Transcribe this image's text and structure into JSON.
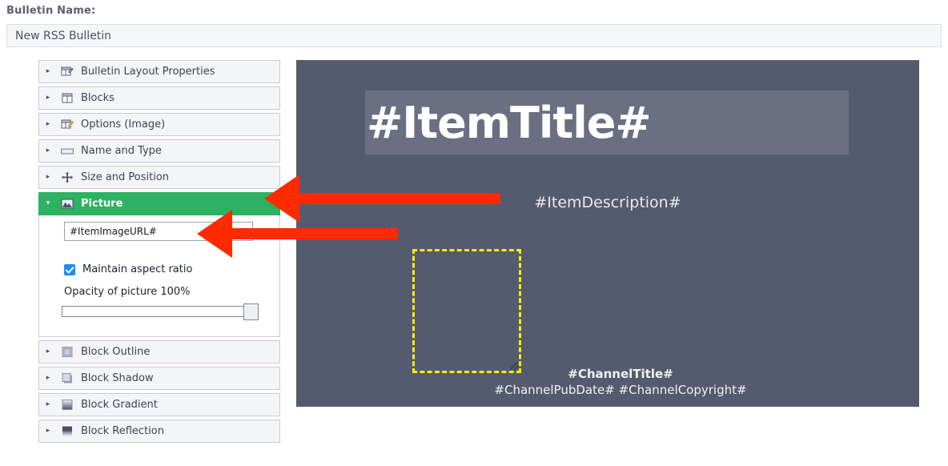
{
  "header": {
    "bulletin_name_label": "Bulletin Name:",
    "bulletin_name_value": "New RSS Bulletin"
  },
  "accordion": {
    "items": [
      {
        "label": "Bulletin Layout Properties",
        "icon": "layout-properties-icon",
        "expanded": false
      },
      {
        "label": "Blocks",
        "icon": "blocks-icon",
        "expanded": false
      },
      {
        "label": "Options (Image)",
        "icon": "options-image-icon",
        "expanded": false
      },
      {
        "label": "Name and Type",
        "icon": "name-and-type-icon",
        "expanded": false
      },
      {
        "label": "Size and Position",
        "icon": "size-and-position-icon",
        "expanded": false
      },
      {
        "label": "Picture",
        "icon": "picture-icon",
        "expanded": true
      },
      {
        "label": "Block Outline",
        "icon": "block-outline-icon",
        "expanded": false
      },
      {
        "label": "Block Shadow",
        "icon": "block-shadow-icon",
        "expanded": false
      },
      {
        "label": "Block Gradient",
        "icon": "block-gradient-icon",
        "expanded": false
      },
      {
        "label": "Block Reflection",
        "icon": "block-reflection-icon",
        "expanded": false
      }
    ],
    "collapsed_arrow": "▸",
    "expanded_arrow": "▾"
  },
  "picture_panel": {
    "image_url_value": "#ItemImageURL#",
    "maintain_aspect_ratio_label": "Maintain aspect ratio",
    "maintain_aspect_ratio_checked": true,
    "opacity_label": "Opacity of picture 100%",
    "opacity_percent": 100
  },
  "preview": {
    "item_title": "#ItemTitle#",
    "item_description": "#ItemDescription#",
    "channel_title": "#ChannelTitle#",
    "channel_meta": "#ChannelPubDate# #ChannelCopyright#",
    "background_color": "#555b6e",
    "title_block_color": "#6a7082",
    "selection_border_color": "#ffed00"
  },
  "annotations": {
    "arrow_color": "#ff2a00",
    "arrows": [
      {
        "name": "arrow-to-picture-section"
      },
      {
        "name": "arrow-to-image-url-field"
      }
    ]
  }
}
